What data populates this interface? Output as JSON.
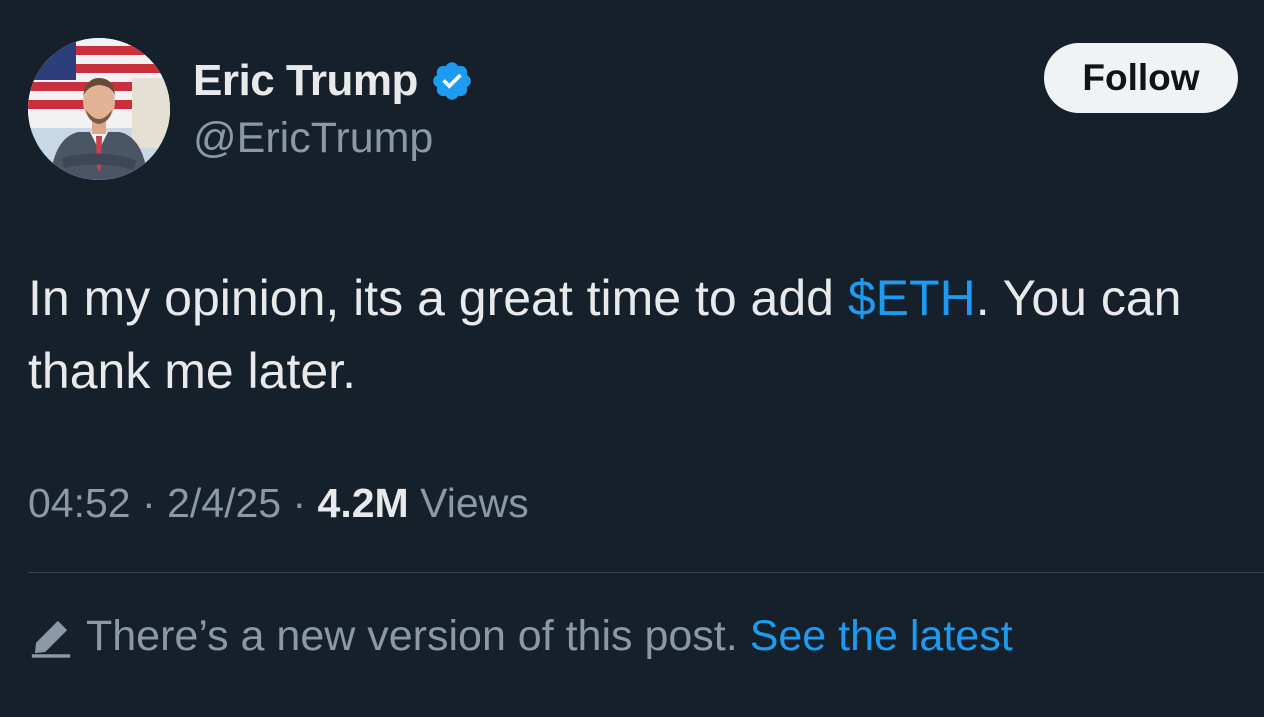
{
  "author": {
    "display_name": "Eric Trump",
    "handle": "@EricTrump",
    "verified": true
  },
  "follow_button_label": "Follow",
  "tweet": {
    "text_before": "In my opinion, its a great time to add ",
    "cashtag": "$ETH",
    "text_after": ". You can thank me later."
  },
  "meta": {
    "time": "04:52",
    "date": "2/4/25",
    "views_count": "4.2M",
    "views_label": "Views",
    "separator": "·"
  },
  "notice": {
    "icon": "pencil-icon",
    "text": "There’s a new version of this post.",
    "link_label": "See the latest"
  },
  "colors": {
    "background": "#15202b",
    "accent": "#1d9bf0",
    "secondary_text": "#8b98a5",
    "primary_text": "#e7e9ea"
  }
}
